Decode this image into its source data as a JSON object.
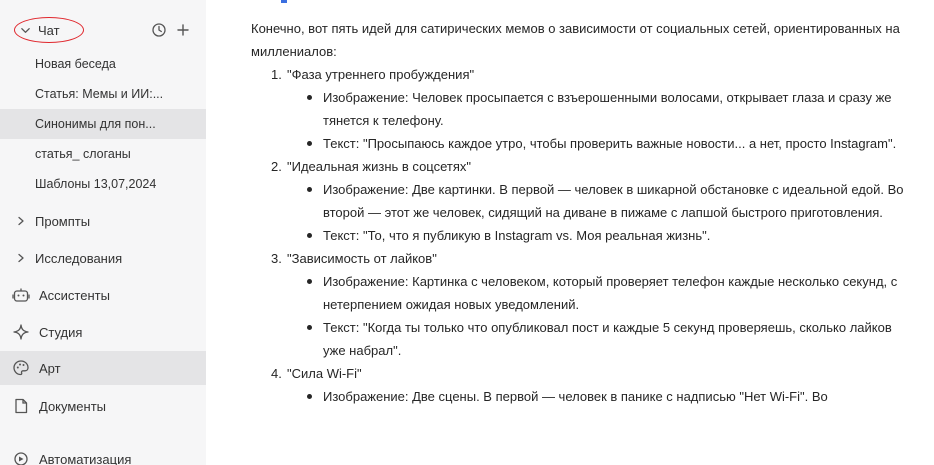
{
  "sidebar": {
    "chat_label": "Чат",
    "chats": [
      {
        "title": "Новая беседа"
      },
      {
        "title": "Статья: Мемы и ИИ:..."
      },
      {
        "title": "Синонимы для пон..."
      },
      {
        "title": "статья_ слоганы"
      },
      {
        "title": "Шаблоны 13,07,2024"
      }
    ],
    "nav": {
      "prompts": "Промпты",
      "research": "Исследования",
      "assistants": "Ассистенты",
      "studio": "Студия",
      "art": "Арт",
      "documents": "Документы",
      "automation": "Автоматизация"
    }
  },
  "response": {
    "intro": "Конечно, вот пять идей для сатирических мемов о зависимости от социальных сетей, ориентированных на миллениалов:",
    "ideas": [
      {
        "num": "1.",
        "title": "\"Фаза утреннего пробуждения\"",
        "points": [
          "Изображение: Человек просыпается с взъерошенными волосами, открывает глаза и сразу же тянется к телефону.",
          "Текст: \"Просыпаюсь каждое утро, чтобы проверить важные новости... а нет, просто Instagram\"."
        ]
      },
      {
        "num": "2.",
        "title": "\"Идеальная жизнь в соцсетях\"",
        "points": [
          "Изображение: Две картинки. В первой — человек в шикарной обстановке с идеальной едой. Во второй — этот же человек, сидящий на диване в пижаме с лапшой быстрого приготовления.",
          "Текст: \"То, что я публикую в Instagram vs. Моя реальная жизнь\"."
        ]
      },
      {
        "num": "3.",
        "title": "\"Зависимость от лайков\"",
        "points": [
          "Изображение: Картинка с человеком, который проверяет телефон каждые несколько секунд, с нетерпением ожидая новых уведомлений.",
          "Текст: \"Когда ты только что опубликовал пост и каждые 5 секунд проверяешь, сколько лайков уже набрал\"."
        ]
      },
      {
        "num": "4.",
        "title": "\"Сила Wi-Fi\"",
        "points": [
          "Изображение: Две сцены. В первой — человек в панике с надписью \"Нет Wi-Fi\". Во"
        ]
      }
    ]
  },
  "colors": {
    "highlight_circle": "#e0262c",
    "sidebar_bg": "#f6f6f7",
    "active_bg": "#e4e4e6"
  }
}
